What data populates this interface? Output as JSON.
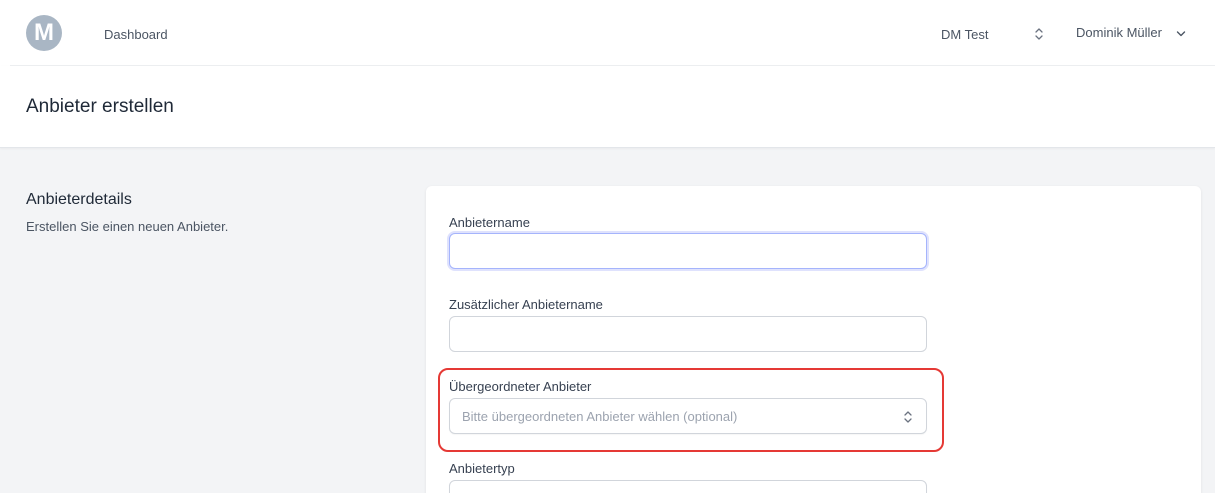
{
  "nav": {
    "logo_letter": "M",
    "dashboard": "Dashboard",
    "tenant": "DM Test",
    "user": "Dominik Müller"
  },
  "header": {
    "title": "Anbieter erstellen"
  },
  "section": {
    "title": "Anbieterdetails",
    "description": "Erstellen Sie einen neuen Anbieter."
  },
  "form": {
    "name": {
      "label": "Anbietername",
      "value": ""
    },
    "additional_name": {
      "label": "Zusätzlicher Anbietername",
      "value": ""
    },
    "parent": {
      "label": "Übergeordneter Anbieter",
      "placeholder": "Bitte übergeordneten Anbieter wählen (optional)"
    },
    "type": {
      "label": "Anbietertyp"
    }
  },
  "colors": {
    "highlight": "#e53935",
    "focus_ring": "#a5b4fc",
    "background": "#f3f4f6"
  }
}
